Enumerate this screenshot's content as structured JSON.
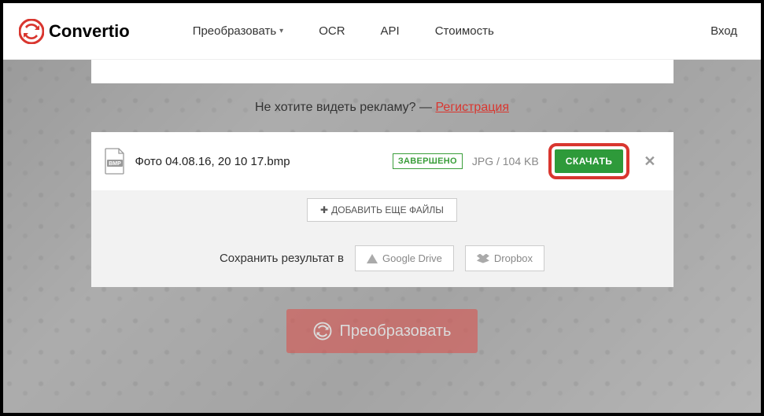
{
  "brand": "Convertio",
  "nav": {
    "convert": "Преобразовать",
    "ocr": "OCR",
    "api": "API",
    "pricing": "Стоимость"
  },
  "login": "Вход",
  "noad": {
    "prefix": "Не хотите видеть рекламу? — ",
    "link": "Регистрация"
  },
  "file": {
    "ext_badge": "BMP",
    "name": "Фото 04.08.16, 20 10 17.bmp",
    "status": "ЗАВЕРШЕНО",
    "meta": "JPG / 104 KB",
    "download": "СКАЧАТЬ"
  },
  "add_more": "ДОБАВИТЬ ЕЩЕ ФАЙЛЫ",
  "save": {
    "label": "Сохранить результат в",
    "gdrive": "Google Drive",
    "dropbox": "Dropbox"
  },
  "convert": "Преобразовать"
}
